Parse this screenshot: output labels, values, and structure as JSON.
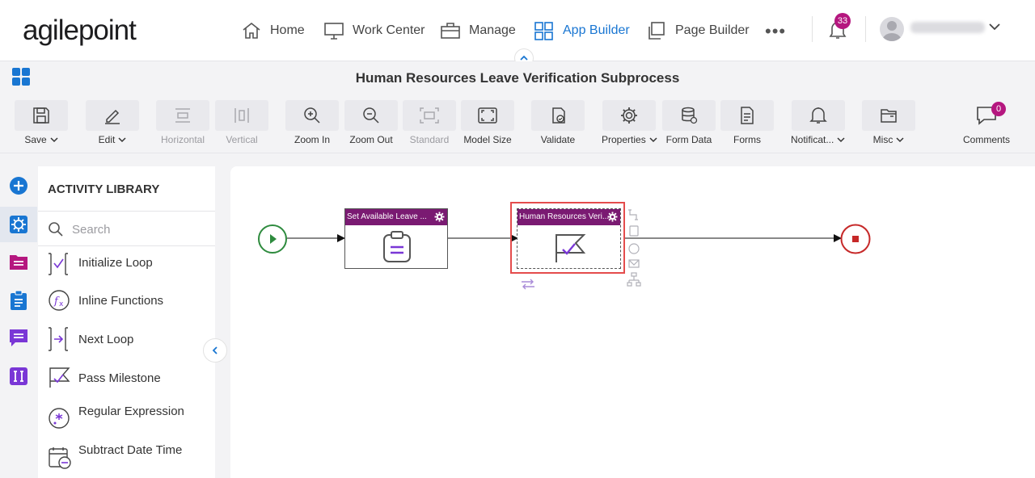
{
  "brand": {
    "logo": "agilepoint"
  },
  "nav": {
    "items": [
      {
        "label": "Home",
        "icon": "home-icon"
      },
      {
        "label": "Work Center",
        "icon": "monitor-icon"
      },
      {
        "label": "Manage",
        "icon": "briefcase-icon"
      },
      {
        "label": "App Builder",
        "icon": "grid-icon",
        "active": true
      },
      {
        "label": "Page Builder",
        "icon": "copy-icon"
      }
    ],
    "more": "•••",
    "notifications_count": "33"
  },
  "title": "Human Resources Leave Verification Subprocess",
  "toolbar": {
    "save": "Save",
    "edit": "Edit",
    "horizontal": "Horizontal",
    "vertical": "Vertical",
    "zoom_in": "Zoom In",
    "zoom_out": "Zoom Out",
    "standard": "Standard",
    "model_size": "Model Size",
    "validate": "Validate",
    "properties": "Properties",
    "form_data": "Form Data",
    "forms": "Forms",
    "notifications": "Notificat...",
    "misc": "Misc",
    "comments": "Comments",
    "comments_count": "0"
  },
  "library": {
    "title": "ACTIVITY LIBRARY",
    "search_placeholder": "Search",
    "items": [
      {
        "label": "Initialize Loop"
      },
      {
        "label": "Inline Functions"
      },
      {
        "label": "Next Loop"
      },
      {
        "label": "Pass Milestone"
      },
      {
        "label": "Regular Expression"
      },
      {
        "label": "Subtract Date Time"
      }
    ]
  },
  "process": {
    "activity1": "Set Available Leave ...",
    "activity2": "Human Resources Veri..."
  },
  "colors": {
    "accent": "#1976d2",
    "activity_header": "#7a1a72",
    "badge": "#b5177f",
    "start": "#2e8b3e",
    "end": "#c62828",
    "selection": "#e44c4c"
  }
}
